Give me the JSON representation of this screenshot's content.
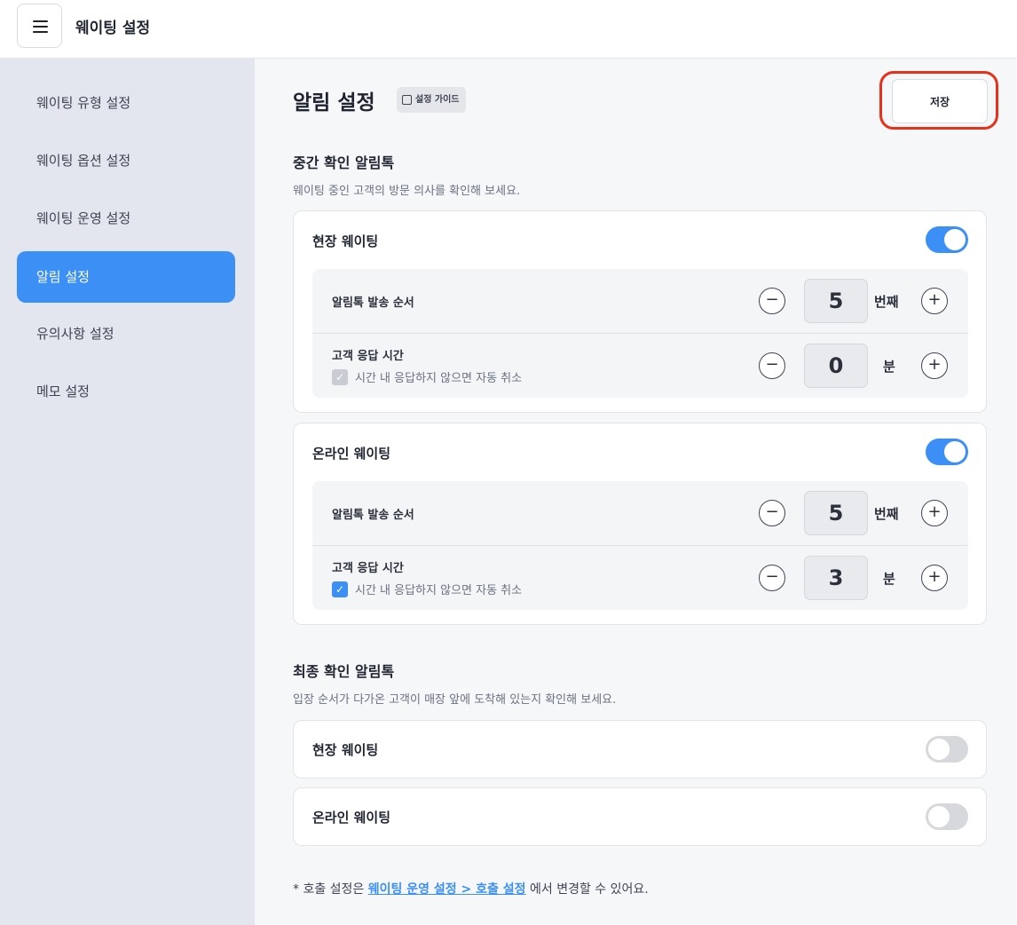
{
  "header": {
    "title": "웨이팅 설정",
    "menu_icon": "hamburger-icon"
  },
  "sidebar": {
    "items": [
      {
        "label": "웨이팅 유형 설정",
        "active": false
      },
      {
        "label": "웨이팅 옵션 설정",
        "active": false
      },
      {
        "label": "웨이팅 운영 설정",
        "active": false
      },
      {
        "label": "알림 설정",
        "active": true
      },
      {
        "label": "유의사항 설정",
        "active": false
      },
      {
        "label": "메모 설정",
        "active": false
      }
    ]
  },
  "main": {
    "title": "알림 설정",
    "guide_label": "설정 가이드",
    "save_label": "저장",
    "intermediate": {
      "title": "중간 확인 알림톡",
      "desc": "웨이팅 중인 고객의 방문 의사를 확인해 보세요.",
      "cards": [
        {
          "title": "현장 웨이팅",
          "enabled": true,
          "send_order_label": "알림톡 발송 순서",
          "send_order_value": "5",
          "send_order_unit": "번째",
          "response_label": "고객 응답 시간",
          "response_value": "0",
          "response_unit": "분",
          "auto_cancel_label": "시간 내 응답하지 않으면 자동 취소",
          "auto_cancel_checked": true,
          "auto_cancel_disabled": true
        },
        {
          "title": "온라인 웨이팅",
          "enabled": true,
          "send_order_label": "알림톡 발송 순서",
          "send_order_value": "5",
          "send_order_unit": "번째",
          "response_label": "고객 응답 시간",
          "response_value": "3",
          "response_unit": "분",
          "auto_cancel_label": "시간 내 응답하지 않으면 자동 취소",
          "auto_cancel_checked": true,
          "auto_cancel_disabled": false
        }
      ]
    },
    "final": {
      "title": "최종 확인 알림톡",
      "desc": "입장 순서가 다가온 고객이 매장 앞에 도착해 있는지 확인해 보세요.",
      "cards": [
        {
          "title": "현장 웨이팅",
          "enabled": false
        },
        {
          "title": "온라인 웨이팅",
          "enabled": false
        }
      ]
    },
    "footnote": {
      "prefix": "* 호출 설정은 ",
      "link": "웨이팅 운영 설정 > 호출 설정",
      "suffix": " 에서 변경할 수 있어요."
    }
  },
  "colors": {
    "accent": "#3b8ff5",
    "highlight": "#e8311a",
    "sidebar_bg": "#e3e5ef"
  }
}
